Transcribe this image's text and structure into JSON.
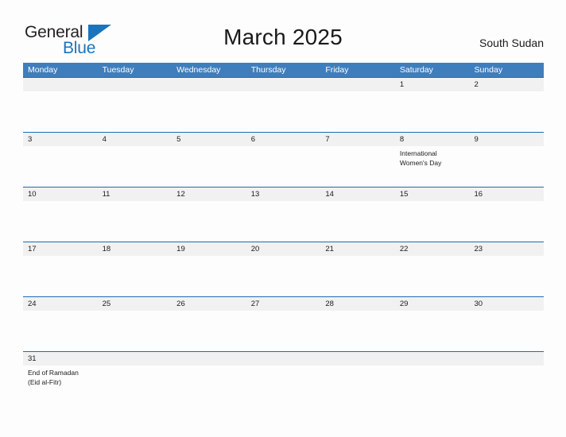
{
  "brand": {
    "name_part1": "General",
    "name_part2": "Blue",
    "flag_icon": "blue-flag-triangle-icon"
  },
  "header": {
    "title": "March 2025",
    "country": "South Sudan"
  },
  "calendar": {
    "weekday_headers": [
      "Monday",
      "Tuesday",
      "Wednesday",
      "Thursday",
      "Friday",
      "Saturday",
      "Sunday"
    ],
    "weeks": [
      {
        "days": [
          {
            "date": "",
            "event": ""
          },
          {
            "date": "",
            "event": ""
          },
          {
            "date": "",
            "event": ""
          },
          {
            "date": "",
            "event": ""
          },
          {
            "date": "",
            "event": ""
          },
          {
            "date": "1",
            "event": ""
          },
          {
            "date": "2",
            "event": ""
          }
        ]
      },
      {
        "days": [
          {
            "date": "3",
            "event": ""
          },
          {
            "date": "4",
            "event": ""
          },
          {
            "date": "5",
            "event": ""
          },
          {
            "date": "6",
            "event": ""
          },
          {
            "date": "7",
            "event": ""
          },
          {
            "date": "8",
            "event": "International\nWomen's Day"
          },
          {
            "date": "9",
            "event": ""
          }
        ]
      },
      {
        "days": [
          {
            "date": "10",
            "event": ""
          },
          {
            "date": "11",
            "event": ""
          },
          {
            "date": "12",
            "event": ""
          },
          {
            "date": "13",
            "event": ""
          },
          {
            "date": "14",
            "event": ""
          },
          {
            "date": "15",
            "event": ""
          },
          {
            "date": "16",
            "event": ""
          }
        ]
      },
      {
        "days": [
          {
            "date": "17",
            "event": ""
          },
          {
            "date": "18",
            "event": ""
          },
          {
            "date": "19",
            "event": ""
          },
          {
            "date": "20",
            "event": ""
          },
          {
            "date": "21",
            "event": ""
          },
          {
            "date": "22",
            "event": ""
          },
          {
            "date": "23",
            "event": ""
          }
        ]
      },
      {
        "days": [
          {
            "date": "24",
            "event": ""
          },
          {
            "date": "25",
            "event": ""
          },
          {
            "date": "26",
            "event": ""
          },
          {
            "date": "27",
            "event": ""
          },
          {
            "date": "28",
            "event": ""
          },
          {
            "date": "29",
            "event": ""
          },
          {
            "date": "30",
            "event": ""
          }
        ]
      },
      {
        "days": [
          {
            "date": "31",
            "event": "End of Ramadan\n(Eid al-Fitr)"
          },
          {
            "date": "",
            "event": ""
          },
          {
            "date": "",
            "event": ""
          },
          {
            "date": "",
            "event": ""
          },
          {
            "date": "",
            "event": ""
          },
          {
            "date": "",
            "event": ""
          },
          {
            "date": "",
            "event": ""
          }
        ]
      }
    ]
  },
  "colors": {
    "header_blue": "#3f7ebc",
    "rule_blue": "#1f6cb0",
    "band_gray": "#f1f1f1",
    "brand_blue": "#1c74bb",
    "text_dark": "#1a1a1a"
  }
}
